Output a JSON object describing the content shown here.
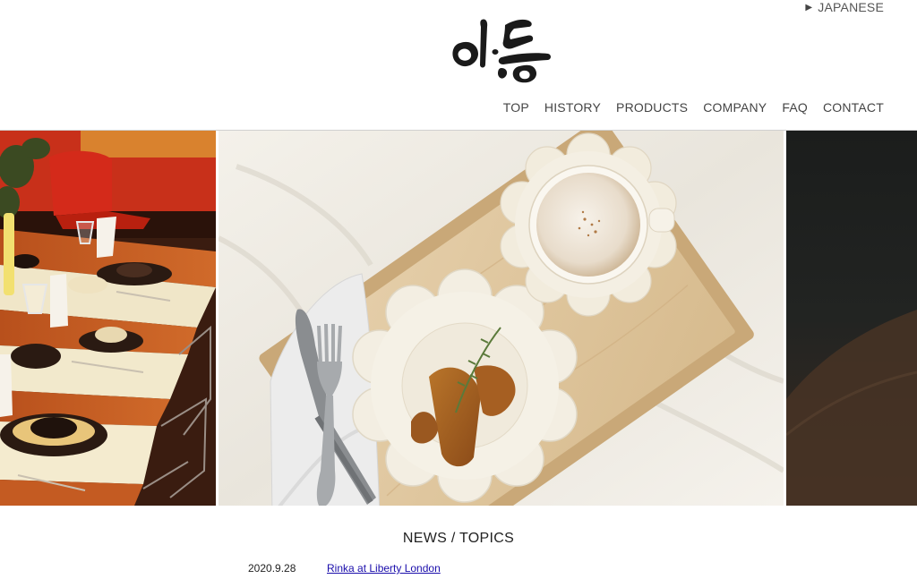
{
  "header": {
    "language_link": {
      "label": "JAPANESE",
      "icon": "play-triangle-icon"
    },
    "logo": {
      "icon": "brand-logo-icon"
    }
  },
  "nav": {
    "items": [
      {
        "label": "TOP"
      },
      {
        "label": "HISTORY"
      },
      {
        "label": "PRODUCTS"
      },
      {
        "label": "COMPANY"
      },
      {
        "label": "FAQ"
      },
      {
        "label": "CONTACT"
      }
    ]
  },
  "hero": {
    "slides": [
      {
        "id": "restaurant-table-setting"
      },
      {
        "id": "tray-latte-toast"
      },
      {
        "id": "dark-wood"
      }
    ]
  },
  "news": {
    "title": "NEWS / TOPICS",
    "items": [
      {
        "date": "2020.9.28",
        "text": "Rinka at Liberty London"
      }
    ]
  },
  "colors": {
    "link": "#1a0dab",
    "nav_text": "#444444",
    "background": "#ffffff"
  }
}
